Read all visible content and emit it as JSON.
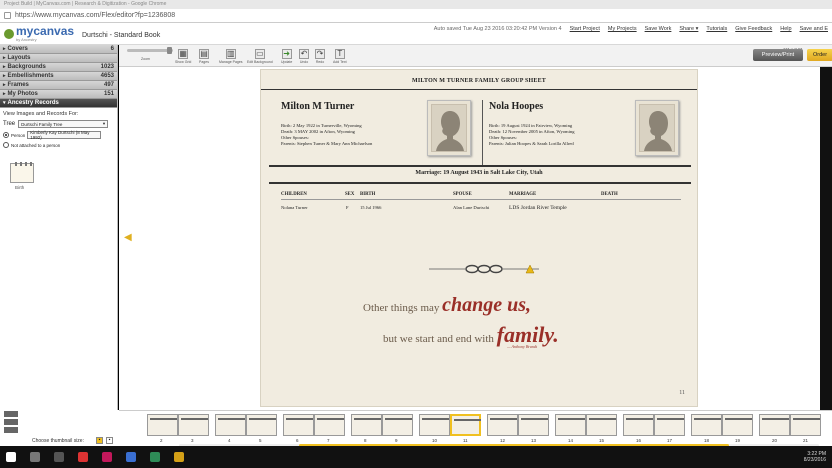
{
  "browser": {
    "title": "Project Build | MyCanvas.com | Research & Digitization - Google Chrome",
    "url": "https://www.mycanvas.com/Flex/editor?fp=1236808"
  },
  "app": {
    "brand": "mycanvas",
    "tagline": "by Ancestry",
    "project_title": "Durtschi - Standard Book",
    "autosave": "Auto saved Tue Aug 23 2016 03:20:42 PM Version 4",
    "links": [
      "Start Project",
      "My Projects",
      "Save Work",
      "Share ▾",
      "Tutorials",
      "Give Feedback",
      "Help",
      "Save and E"
    ]
  },
  "sidebar": {
    "items": [
      {
        "label": "Covers",
        "count": "6"
      },
      {
        "label": "Layouts",
        "count": ""
      },
      {
        "label": "Backgrounds",
        "count": "1023"
      },
      {
        "label": "Embellishments",
        "count": "4653"
      },
      {
        "label": "Frames",
        "count": "497"
      },
      {
        "label": "My Photos",
        "count": "151"
      },
      {
        "label": "Ancestry Records",
        "count": ""
      }
    ],
    "ancestry": {
      "view_label": "View Images and Records For:",
      "tree_label": "Tree",
      "tree_value": "Durtschi Family Tree",
      "person_label": "Person",
      "person_value": "Kimberly Kay Durtschi (8 May 1992)",
      "not_attached_label": "Not attached to a person",
      "record_label": "Birth"
    }
  },
  "toolbar": {
    "zoom_label": "Zoom",
    "show_grid": "Show Grid",
    "pages": "Pages",
    "manage_pages": "Manage Pages",
    "edit_background": "Edit Background",
    "update": "Update",
    "undo": "Undo",
    "redo": "Redo",
    "add_text": "Add Text",
    "page_size": "11\" × 8.5\"",
    "preview_print": "Preview/Print",
    "order": "Order"
  },
  "page": {
    "header": "MILTON M TURNER FAMILY GROUP SHEET",
    "husband": {
      "name": "Milton M Turner",
      "birth": "Birth: 2 May 1922 in Turnerville, Wyoming",
      "death": "Death: 3 MAY 2002 in Afton, Wyoming",
      "spouses_label": "Other Spouses:",
      "parents": "Parents: Stephen Turner & Mary Ann Michaelson"
    },
    "wife": {
      "name": "Nola Hoopes",
      "birth": "Birth: 19 August 1924 in Fairview, Wyoming",
      "death": "Death: 12 November 2005 in Afton, Wyoming",
      "spouses_label": "Other Spouses:",
      "parents": "Parents: Julian Hoopes & Sarah Lorilla Allred"
    },
    "marriage": "Marriage:  19 August 1943 in Salt Lake City, Utah",
    "columns": [
      "CHILDREN",
      "SEX",
      "BIRTH",
      "SPOUSE",
      "MARRIAGE",
      "DEATH"
    ],
    "row": [
      "Nolana Turner",
      "F",
      "15 Jul 1966",
      "Alan Lane Durtschi",
      "LDS Jordan River Temple",
      ""
    ],
    "quote_line1_a": "Other things may ",
    "quote_line1_b": "change us,",
    "quote_line2_a": "but we start and end with ",
    "quote_line2_b": "family.",
    "quote_author": "— Anthony Brandt",
    "page_number": "11"
  },
  "filmstrip": {
    "thumb_size_label": "Choose thumbnail size:",
    "numbers": [
      "2",
      "3",
      "4",
      "5",
      "6",
      "7",
      "8",
      "9",
      "10",
      "11",
      "12",
      "13",
      "14",
      "15",
      "16",
      "17",
      "18",
      "19",
      "20",
      "21"
    ],
    "selected_page": "11"
  },
  "taskbar": {
    "time": "3:22 PM",
    "date": "8/23/2016"
  }
}
